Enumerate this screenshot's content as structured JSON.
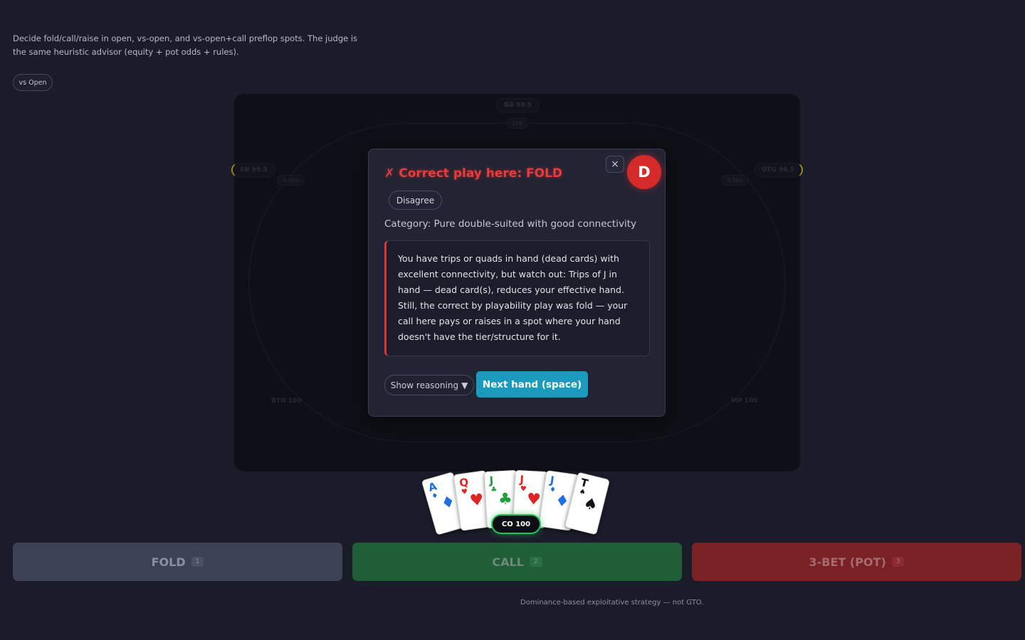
{
  "intro": {
    "text": "Decide fold/call/raise in open, vs-open, and vs-open+call preflop spots. The judge is the same heuristic advisor (equity + pot odds + rules)."
  },
  "mode": {
    "label": "vs Open"
  },
  "table": {
    "seats": [
      {
        "label": "BB 99.5",
        "bet": "1bb"
      },
      {
        "label": "SB 99.5",
        "bet": "0.5bb"
      },
      {
        "label": "UTG 96.5",
        "bet": "3.5bb"
      },
      {
        "label": "BTN 100"
      },
      {
        "label": "MP 100"
      }
    ]
  },
  "modal": {
    "title_icon": "✗",
    "title": "Correct play here: FOLD",
    "close_label": "×",
    "grade": "D",
    "disagree_label": "Disagree",
    "category": "Category: Pure double-suited with good connectivity",
    "explanation": "You have trips or quads in hand (dead cards) with excellent connectivity, but watch out: Trips of J in hand — dead card(s), reduces your effective hand. Still, the correct by playability play was fold — your call here pays or raises in a spot where your hand doesn't have the tier/structure for it.",
    "reasoning_label": "Show reasoning",
    "reasoning_caret": "▼",
    "next_label": "Next hand (space)"
  },
  "hand": {
    "cards": [
      {
        "rank": "A",
        "suit": "♦",
        "color": "#1e6fe0"
      },
      {
        "rank": "Q",
        "suit": "♥",
        "color": "#e02424"
      },
      {
        "rank": "J",
        "suit": "♣",
        "color": "#1f9e3c"
      },
      {
        "rank": "J",
        "suit": "♥",
        "color": "#e02424"
      },
      {
        "rank": "J",
        "suit": "♦",
        "color": "#1e6fe0"
      },
      {
        "rank": "T",
        "suit": "♠",
        "color": "#111111"
      }
    ],
    "hero_tag": "CO 100"
  },
  "actions": {
    "fold": {
      "label": "FOLD",
      "key": "1"
    },
    "call": {
      "label": "CALL",
      "key": "2"
    },
    "raise": {
      "label": "3-BET (POT)",
      "key": "3"
    }
  },
  "footer": "Dominance-based exploitative strategy — not GTO."
}
